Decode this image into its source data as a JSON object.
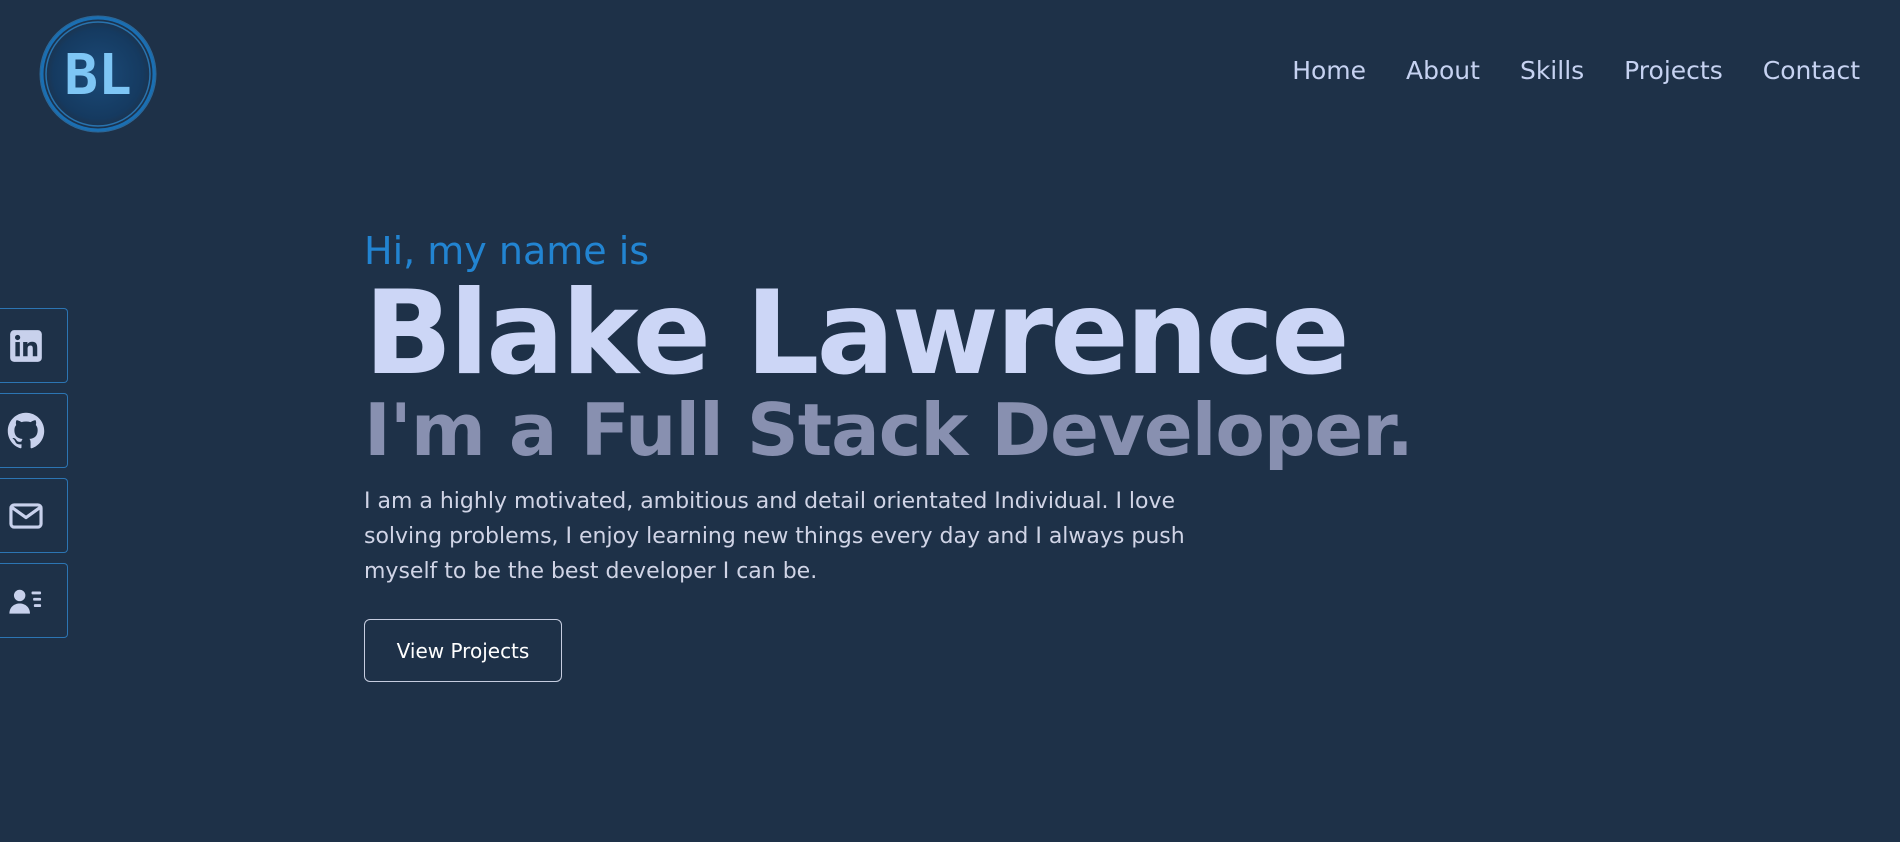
{
  "logo": {
    "text": "BL",
    "ring_color": "#1a6fb3",
    "text_color": "#7ec6f5"
  },
  "nav": {
    "items": [
      {
        "label": "Home"
      },
      {
        "label": "About"
      },
      {
        "label": "Skills"
      },
      {
        "label": "Projects"
      },
      {
        "label": "Contact"
      }
    ]
  },
  "social": {
    "items": [
      {
        "icon": "linkedin-icon"
      },
      {
        "icon": "github-icon"
      },
      {
        "icon": "mail-icon"
      },
      {
        "icon": "contact-card-icon"
      }
    ]
  },
  "hero": {
    "greeting": "Hi, my name is",
    "name": "Blake Lawrence",
    "tagline": "I'm a Full Stack Developer.",
    "bio": "I am a highly motivated, ambitious and detail orientated Individual. I love solving problems, I enjoy learning new things every day and I always push myself to be the best developer I can be.",
    "cta_label": "View Projects"
  },
  "colors": {
    "background": "#1e3148",
    "accent": "#2284d1",
    "heading": "#ccd6f6",
    "subheading": "#8890b0",
    "border": "#2c75b3"
  }
}
